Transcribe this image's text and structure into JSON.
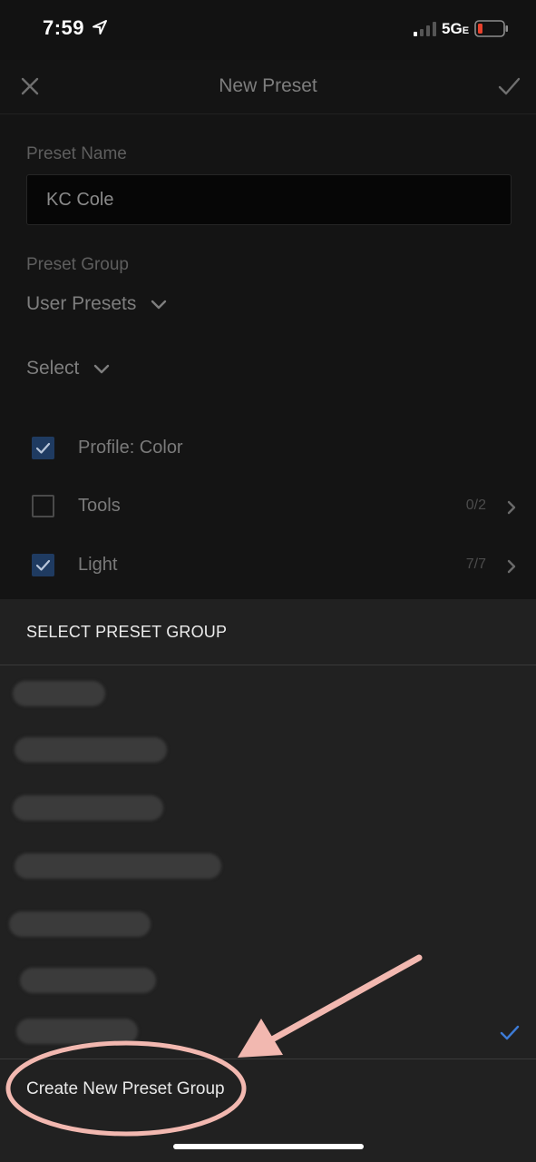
{
  "status_bar": {
    "time": "7:59",
    "network": "5G",
    "network_suffix": "E"
  },
  "header": {
    "title": "New Preset"
  },
  "form": {
    "preset_name_label": "Preset Name",
    "preset_name_value": "KC Cole",
    "preset_group_label": "Preset Group",
    "preset_group_value": "User Presets",
    "select_label": "Select"
  },
  "options": [
    {
      "label": "Profile: Color",
      "checked": true,
      "count": ""
    },
    {
      "label": "Tools",
      "checked": false,
      "count": "0/2"
    },
    {
      "label": "Light",
      "checked": true,
      "count": "7/7"
    }
  ],
  "sheet": {
    "title": "SELECT PRESET GROUP",
    "create_label": "Create New Preset Group"
  },
  "colors": {
    "accent": "#3d7bd6",
    "annotation": "#f2b8b0"
  }
}
